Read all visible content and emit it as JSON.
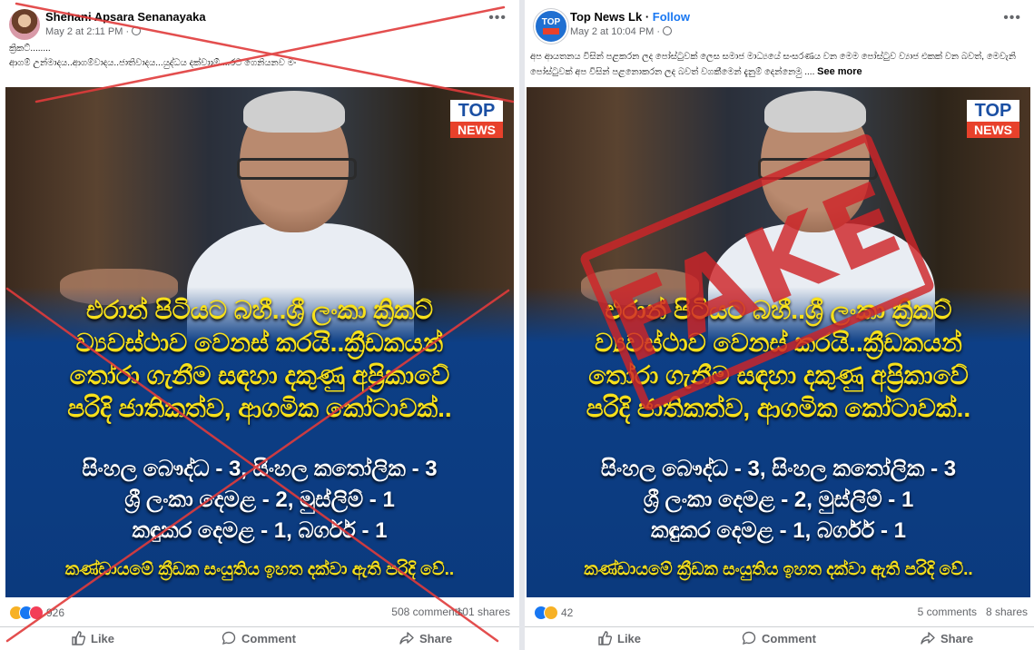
{
  "left_post": {
    "author": "Shehani Apsara Senanayaka",
    "date": "May 2 at 2:11 PM",
    "caption_line1": "ක්‍රිකට්........",
    "caption_line2": "ආගම් උන්මාදය..ආගම්වාදය..ජාතිවාදය...යුද්ධය දක්වාාම්....රට ගෙනියනව මං",
    "image": {
      "logo_top": "TOP",
      "logo_news": "NEWS",
      "headline": [
        "එරාන් පිටියට බහී..ශ්‍රී ලංකා ක්‍රිකට්",
        "ව්‍යවස්ථාව වෙනස් කරයි..ක්‍රීඩකයන්",
        "තෝරා ගැනීම සඳහා දකුණු අප්‍රිකාවේ",
        "පරිදි ජාතිකත්ව, ආගමික කෝටාවක්.."
      ],
      "quota": [
        "සිංහල බෞද්ධ - 3, සිංහල කතෝලික - 3",
        "ශ්‍රී ලංකා දෙමළ - 2, මුස්ලිම් - 1",
        "කඳුකර දෙමළ - 1, බර්ගර් - 1"
      ],
      "footer": "කණ්ඩායමේ ක්‍රීඩක සංයුතිය ඉහත දක්වා ඇති පරිදි වේ.."
    },
    "reactions_count": "926",
    "comments": "508 comments",
    "shares": "101 shares",
    "actions": {
      "like": "Like",
      "comment": "Comment",
      "share": "Share"
    },
    "cross_color": "#e03b3b"
  },
  "right_post": {
    "author": "Top News Lk",
    "follow": "Follow",
    "date": "May 2 at 10:04 PM",
    "avatar_text": "TOP",
    "caption": "අප ආයතනය විසින් පළකරන ලද පෝස්ටුවක් ලෙස සමාජ මාධ්‍යයේ සංසරණය වන මෙම පෝස්ටුව ව්‍යාජ එකක් වන බවත්, මෙවැනි පෝස්ටුවක් අප විසින් පළනොකරන ලද බවත් වගකීමෙන් දැනුම් දෙන්නෙමු ....",
    "see_more": "See more",
    "stamp_text": "FAKE",
    "stamp_color": "#ce2428",
    "image": {
      "logo_top": "TOP",
      "logo_news": "NEWS",
      "headline": [
        "එරාන් පිටියට බහී..ශ්‍රී ලංකා ක්‍රිකට්",
        "ව්‍යවස්ථාව වෙනස් කරයි..ක්‍රීඩකයන්",
        "තෝරා ගැනීම සඳහා දකුණු අප්‍රිකාවේ",
        "පරිදි ජාතිකත්ව, ආගමික කෝටාවක්.."
      ],
      "quota": [
        "සිංහල බෞද්ධ - 3, සිංහල කතෝලික - 3",
        "ශ්‍රී ලංකා දෙමළ - 2, මුස්ලිම් - 1",
        "කඳුකර දෙමළ - 1, බර්ගර් - 1"
      ],
      "footer": "කණ්ඩායමේ ක්‍රීඩක සංයුතිය ඉහත දක්වා ඇති පරිදි වේ.."
    },
    "reactions_count": "42",
    "comments": "5 comments",
    "shares": "8 shares",
    "actions": {
      "like": "Like",
      "comment": "Comment",
      "share": "Share"
    }
  },
  "colors": {
    "facebook_blue": "#1877f2",
    "headline_yellow": "#f7e01a",
    "image_blue": "#0d3f86"
  }
}
